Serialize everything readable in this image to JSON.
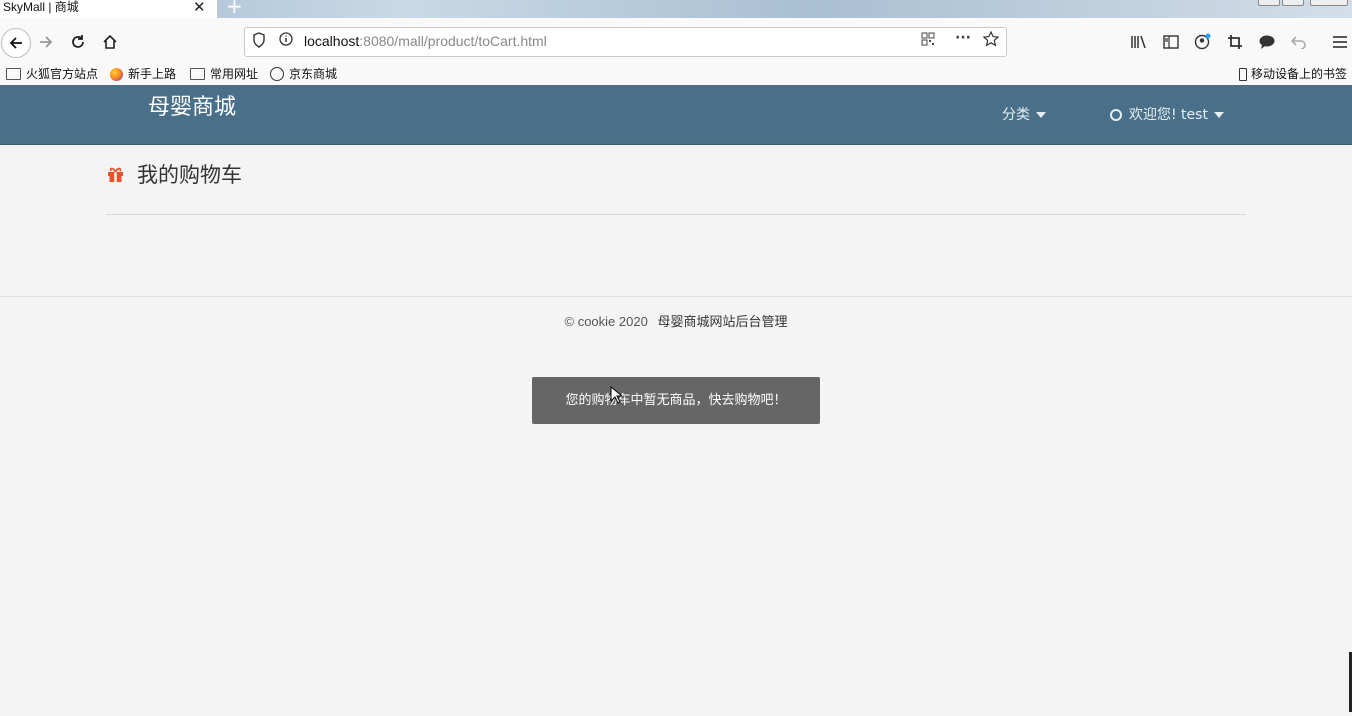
{
  "browser": {
    "tab_title": "SkyMall | 商城",
    "tab_close": "✕",
    "new_tab": "+",
    "url_host": "localhost",
    "url_rest": ":8080/mall/product/toCart.html",
    "bookmarks": [
      {
        "label": "火狐官方站点",
        "icon": "folder-icon"
      },
      {
        "label": "新手上路",
        "icon": "firefox-icon"
      },
      {
        "label": "常用网址",
        "icon": "folder-icon"
      },
      {
        "label": "京东商城",
        "icon": "globe-icon"
      }
    ],
    "mobile_bookmarks": "移动设备上的书签"
  },
  "site": {
    "brand": "母婴商城",
    "menu_category": "分类",
    "menu_user": "欢迎您! test"
  },
  "main": {
    "page_title": "我的购物车",
    "accent_color": "#e8542a"
  },
  "footer": {
    "copyright": "© cookie 2020",
    "link": "母婴商城网站后台管理"
  },
  "toast": {
    "message": "您的购物车中暂无商品，快去购物吧！"
  }
}
